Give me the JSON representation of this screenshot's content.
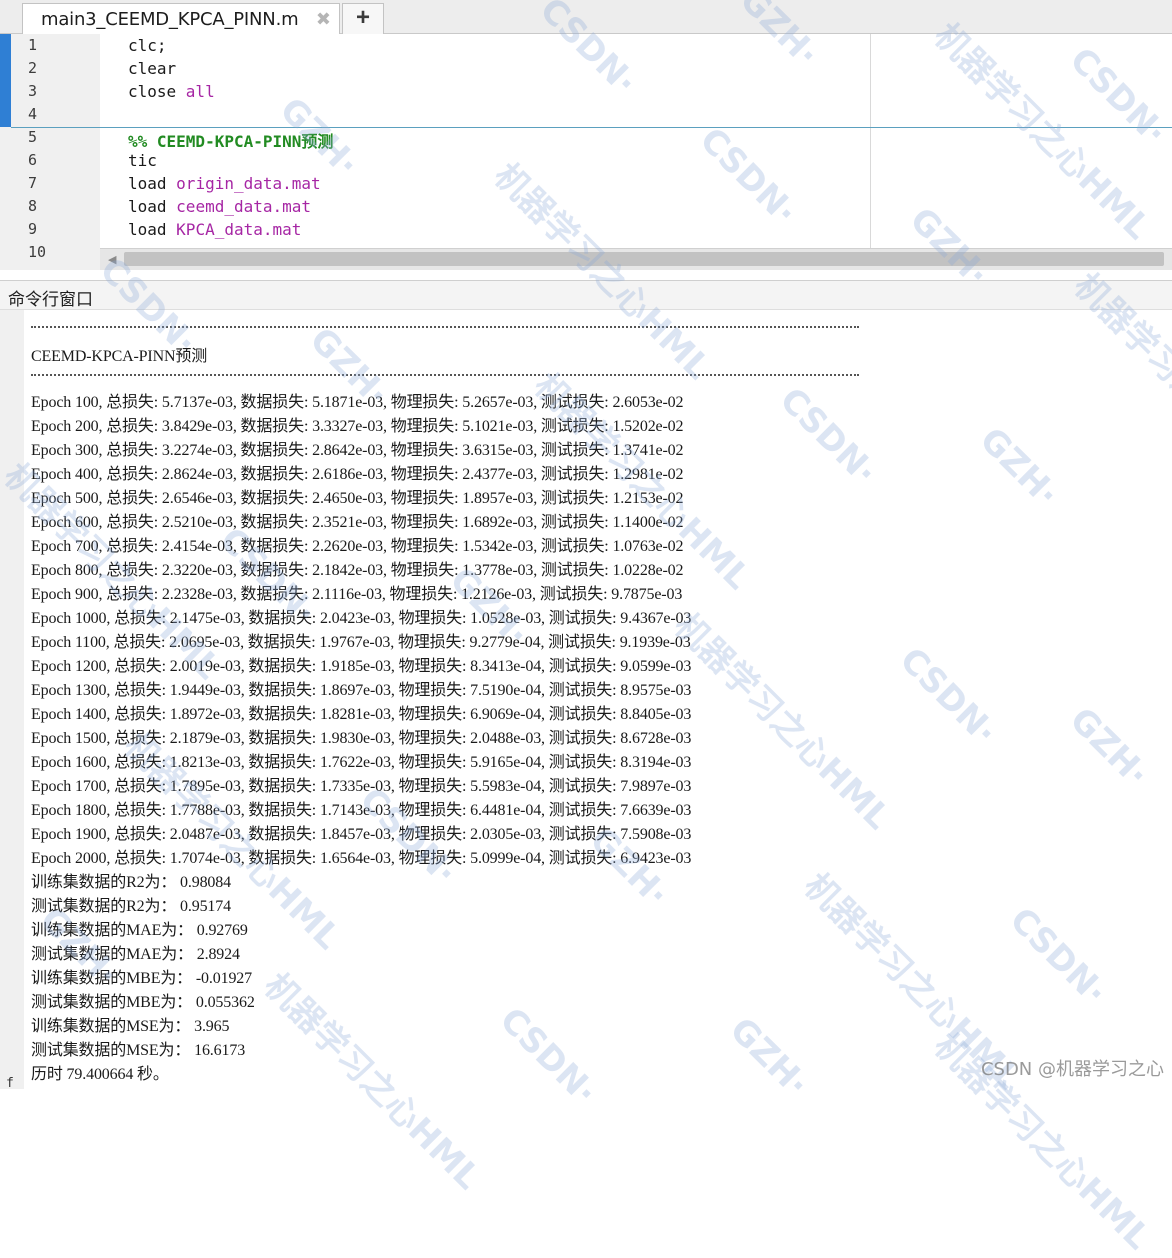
{
  "editor": {
    "tab_title": "main3_CEEMD_KPCA_PINN.m",
    "tab_close_glyph": "✖",
    "new_tab_glyph": "+",
    "lines": [
      {
        "num": "1",
        "segments": [
          {
            "t": "clc;",
            "c": "plain"
          }
        ]
      },
      {
        "num": "2",
        "segments": [
          {
            "t": "clear",
            "c": "plain"
          }
        ]
      },
      {
        "num": "3",
        "segments": [
          {
            "t": "close ",
            "c": "plain"
          },
          {
            "t": "all",
            "c": "purple"
          }
        ]
      },
      {
        "num": "4",
        "segments": []
      },
      {
        "num": "5",
        "segments": [
          {
            "t": "%% CEEMD-KPCA-PINN预测",
            "c": "comment"
          }
        ]
      },
      {
        "num": "6",
        "segments": [
          {
            "t": "tic",
            "c": "plain"
          }
        ]
      },
      {
        "num": "7",
        "segments": [
          {
            "t": "load ",
            "c": "plain"
          },
          {
            "t": "origin_data.mat",
            "c": "purple"
          }
        ]
      },
      {
        "num": "8",
        "segments": [
          {
            "t": "load ",
            "c": "plain"
          },
          {
            "t": "ceemd_data.mat",
            "c": "purple"
          }
        ]
      },
      {
        "num": "9",
        "segments": [
          {
            "t": "load ",
            "c": "plain"
          },
          {
            "t": "KPCA_data.mat",
            "c": "purple"
          }
        ]
      },
      {
        "num": "10",
        "segments": []
      }
    ]
  },
  "command_window": {
    "title": "命令行窗口",
    "prompt": "f",
    "heading": "CEEMD-KPCA-PINN预测",
    "epochs": [
      "Epoch 100, 总损失: 5.7137e-03, 数据损失: 5.1871e-03, 物理损失: 5.2657e-03, 测试损失: 2.6053e-02",
      "Epoch 200, 总损失: 3.8429e-03, 数据损失: 3.3327e-03, 物理损失: 5.1021e-03, 测试损失: 1.5202e-02",
      "Epoch 300, 总损失: 3.2274e-03, 数据损失: 2.8642e-03, 物理损失: 3.6315e-03, 测试损失: 1.3741e-02",
      "Epoch 400, 总损失: 2.8624e-03, 数据损失: 2.6186e-03, 物理损失: 2.4377e-03, 测试损失: 1.2981e-02",
      "Epoch 500, 总损失: 2.6546e-03, 数据损失: 2.4650e-03, 物理损失: 1.8957e-03, 测试损失: 1.2153e-02",
      "Epoch 600, 总损失: 2.5210e-03, 数据损失: 2.3521e-03, 物理损失: 1.6892e-03, 测试损失: 1.1400e-02",
      "Epoch 700, 总损失: 2.4154e-03, 数据损失: 2.2620e-03, 物理损失: 1.5342e-03, 测试损失: 1.0763e-02",
      "Epoch 800, 总损失: 2.3220e-03, 数据损失: 2.1842e-03, 物理损失: 1.3778e-03, 测试损失: 1.0228e-02",
      "Epoch 900, 总损失: 2.2328e-03, 数据损失: 2.1116e-03, 物理损失: 1.2126e-03, 测试损失: 9.7875e-03",
      "Epoch 1000, 总损失: 2.1475e-03, 数据损失: 2.0423e-03, 物理损失: 1.0528e-03, 测试损失: 9.4367e-03",
      "Epoch 1100, 总损失: 2.0695e-03, 数据损失: 1.9767e-03, 物理损失: 9.2779e-04, 测试损失: 9.1939e-03",
      "Epoch 1200, 总损失: 2.0019e-03, 数据损失: 1.9185e-03, 物理损失: 8.3413e-04, 测试损失: 9.0599e-03",
      "Epoch 1300, 总损失: 1.9449e-03, 数据损失: 1.8697e-03, 物理损失: 7.5190e-04, 测试损失: 8.9575e-03",
      "Epoch 1400, 总损失: 1.8972e-03, 数据损失: 1.8281e-03, 物理损失: 6.9069e-04, 测试损失: 8.8405e-03",
      "Epoch 1500, 总损失: 2.1879e-03, 数据损失: 1.9830e-03, 物理损失: 2.0488e-03, 测试损失: 8.6728e-03",
      "Epoch 1600, 总损失: 1.8213e-03, 数据损失: 1.7622e-03, 物理损失: 5.9165e-04, 测试损失: 8.3194e-03",
      "Epoch 1700, 总损失: 1.7895e-03, 数据损失: 1.7335e-03, 物理损失: 5.5983e-04, 测试损失: 7.9897e-03",
      "Epoch 1800, 总损失: 1.7788e-03, 数据损失: 1.7143e-03, 物理损失: 6.4481e-04, 测试损失: 7.6639e-03",
      "Epoch 1900, 总损失: 2.0487e-03, 数据损失: 1.8457e-03, 物理损失: 2.0305e-03, 测试损失: 7.5908e-03",
      "Epoch 2000, 总损失: 1.7074e-03, 数据损失: 1.6564e-03, 物理损失: 5.0999e-04, 测试损失: 6.9423e-03"
    ],
    "metrics": [
      "训练集数据的R2为： 0.98084",
      "测试集数据的R2为： 0.95174",
      "训练集数据的MAE为： 0.92769",
      "测试集数据的MAE为： 2.8924",
      "训练集数据的MBE为： -0.01927",
      "测试集数据的MBE为： 0.055362",
      "训练集数据的MSE为： 3.965",
      "测试集数据的MSE为： 16.6173",
      "历时 79.400664 秒。"
    ]
  },
  "watermark": {
    "footer": "CSDN @机器学习之心",
    "marks": [
      "CSDN·",
      "GZH·",
      "机器学习之心HML",
      "CSDN·",
      "GZH·",
      "机器学习之心HML",
      "CSDN·",
      "GZH·",
      "机器学习之心HML",
      "CSDN·",
      "GZH·",
      "机器学习之心HML"
    ]
  },
  "colors": {
    "code_purple": "#a626a4",
    "code_comment": "#228b22",
    "gutter_marker": "#2f7fd4"
  }
}
